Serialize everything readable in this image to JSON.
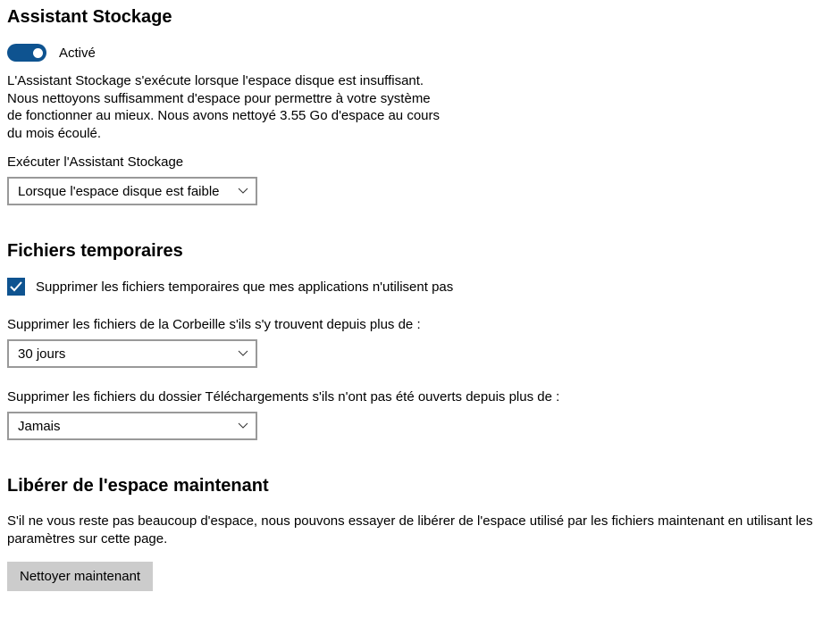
{
  "storage_assistant": {
    "heading": "Assistant Stockage",
    "toggle_state": "Activé",
    "description": "L'Assistant Stockage s'exécute lorsque l'espace disque est insuffisant. Nous nettoyons suffisamment d'espace pour permettre à votre système de fonctionner au mieux. Nous avons nettoyé 3.55 Go d'espace au cours du mois écoulé.",
    "run_label": "Exécuter l'Assistant Stockage",
    "run_value": "Lorsque l'espace disque est faible"
  },
  "temp_files": {
    "heading": "Fichiers temporaires",
    "delete_unused_label": "Supprimer les fichiers temporaires que mes applications n'utilisent pas",
    "delete_unused_checked": true,
    "recycle_label": "Supprimer les fichiers de la Corbeille s'ils s'y trouvent depuis plus de :",
    "recycle_value": "30 jours",
    "downloads_label": "Supprimer les fichiers du dossier Téléchargements s'ils n'ont pas été ouverts depuis plus de :",
    "downloads_value": "Jamais"
  },
  "free_space": {
    "heading": "Libérer de l'espace maintenant",
    "description": "S'il ne vous reste pas beaucoup d'espace, nous pouvons essayer de libérer de l'espace utilisé par les fichiers maintenant en utilisant les paramètres sur cette page.",
    "clean_button": "Nettoyer maintenant"
  }
}
